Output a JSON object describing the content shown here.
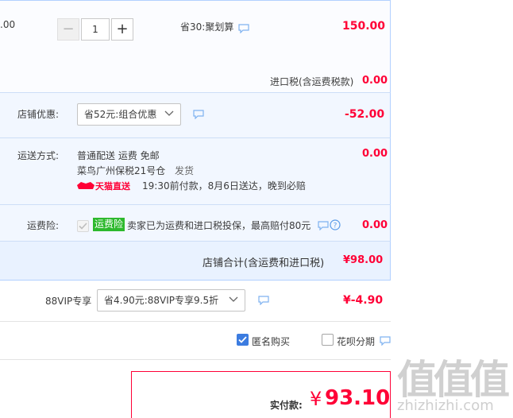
{
  "item": {
    "price_partial": ".00",
    "qty_minus": "−",
    "qty_value": "1",
    "qty_plus": "+",
    "promo_label": "省30:聚划算",
    "subtotal": "150.00",
    "tax_label": "进口税(含运费税款)",
    "tax_value": "0.00"
  },
  "shop_discount": {
    "label": "店铺优惠:",
    "selected": "省52元:组合优惠",
    "amount": "-52.00"
  },
  "shipping": {
    "label": "运送方式:",
    "method": "普通配送 运费 免邮",
    "warehouse": "菜鸟广州保税21号仓",
    "dispatch": "发货",
    "brand": "天猫直送",
    "promise": "19:30前付款，8月6日送达，晚到必赔",
    "fee": "0.00"
  },
  "insurance": {
    "label": "运费险:",
    "badge": "运费险",
    "text": "卖家已为运费和进口税投保，最高赔付80元",
    "fee": "0.00"
  },
  "shop_total": {
    "label": "店铺合计(含运费和进口税)",
    "value": "¥98.00"
  },
  "vip": {
    "label": "88VIP专享",
    "selected": "省4.90元:88VIP专享9.5折",
    "amount": "¥-4.90"
  },
  "options": {
    "anonymous": "匿名购买",
    "huabei": "花呗分期"
  },
  "payment": {
    "label": "实付款:",
    "currency": "¥",
    "amount": "93.10"
  },
  "watermark": {
    "logo": "值值值",
    "domain": "zhizhizhi.com"
  },
  "colors": {
    "accent_red": "#ff0036",
    "panel_blue": "#f2f7ff",
    "checkbox_blue": "#3c7ce0",
    "badge_green": "#2db92d"
  }
}
